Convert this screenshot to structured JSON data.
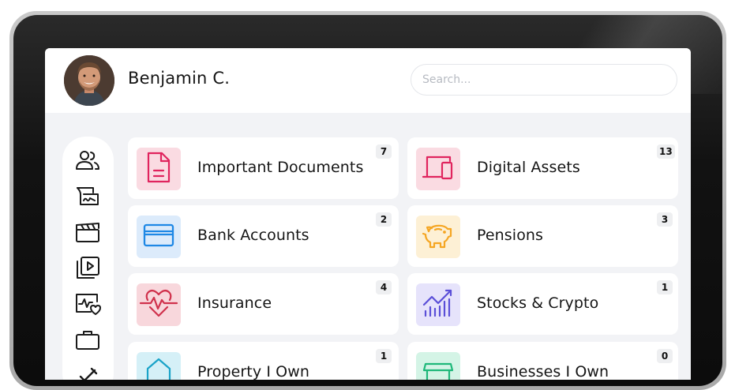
{
  "user": {
    "name": "Benjamin C."
  },
  "search": {
    "placeholder": "Search..."
  },
  "sidebar": {
    "items": [
      {
        "icon": "people-icon"
      },
      {
        "icon": "signed-document-icon"
      },
      {
        "icon": "clapperboard-icon"
      },
      {
        "icon": "video-library-icon"
      },
      {
        "icon": "health-heart-icon"
      },
      {
        "icon": "briefcase-icon"
      },
      {
        "icon": "pen-icon"
      }
    ]
  },
  "categories": [
    {
      "label": "Important Documents",
      "count": "7",
      "icon": "document-icon",
      "color": "#e0245e",
      "tile": "#fadbe2"
    },
    {
      "label": "Digital Assets",
      "count": "13",
      "icon": "devices-icon",
      "color": "#e0245e",
      "tile": "#fadbe2"
    },
    {
      "label": "Bank Accounts",
      "count": "2",
      "icon": "credit-card-icon",
      "color": "#1e88e5",
      "tile": "#dcebfb"
    },
    {
      "label": "Pensions",
      "count": "3",
      "icon": "piggy-bank-icon",
      "color": "#f5a623",
      "tile": "#fdf0d5"
    },
    {
      "label": "Insurance",
      "count": "4",
      "icon": "heart-pulse-icon",
      "color": "#d0314c",
      "tile": "#f8d7dc"
    },
    {
      "label": "Stocks & Crypto",
      "count": "1",
      "icon": "stock-chart-icon",
      "color": "#5b4fd8",
      "tile": "#e6e3fb"
    },
    {
      "label": "Property I Own",
      "count": "1",
      "icon": "house-icon",
      "color": "#1aa3c8",
      "tile": "#d5f0f7"
    },
    {
      "label": "Businesses I Own",
      "count": "0",
      "icon": "store-icon",
      "color": "#1fb87a",
      "tile": "#d4f4e6"
    }
  ]
}
